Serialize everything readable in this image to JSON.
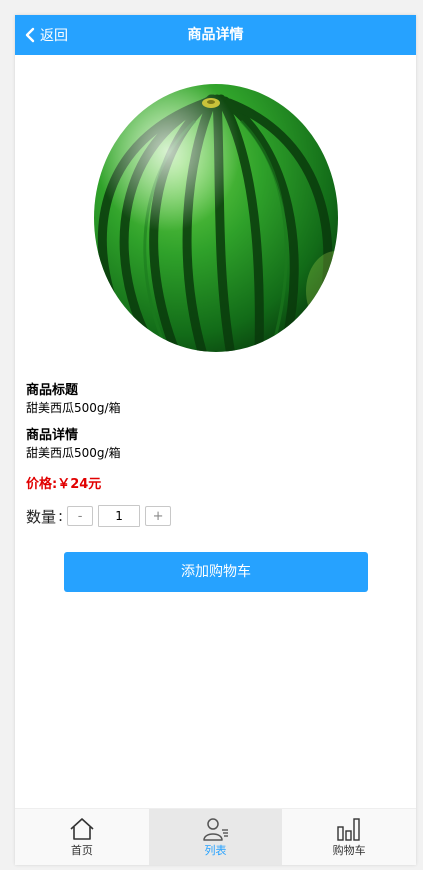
{
  "header": {
    "back_label": "返回",
    "title": "商品详情"
  },
  "product": {
    "image_icon": "watermelon-image",
    "title_heading": "商品标题",
    "title_value": "甜美西瓜500g/箱",
    "detail_heading": "商品详情",
    "detail_value": "甜美西瓜500g/箱",
    "price_text": "价格:￥24元"
  },
  "quantity": {
    "label": "数量",
    "colon": ":",
    "minus": "-",
    "plus": "+",
    "value": "1"
  },
  "actions": {
    "add_cart_label": "添加购物车"
  },
  "tabbar": {
    "tabs": [
      {
        "label": "首页",
        "icon": "home-icon"
      },
      {
        "label": "列表",
        "icon": "user-list-icon",
        "active": true
      },
      {
        "label": "购物车",
        "icon": "bar-chart-icon"
      }
    ]
  },
  "colors": {
    "accent": "#26a2ff",
    "price": "#e10000",
    "active_tab_bg": "#e8e8e8"
  }
}
